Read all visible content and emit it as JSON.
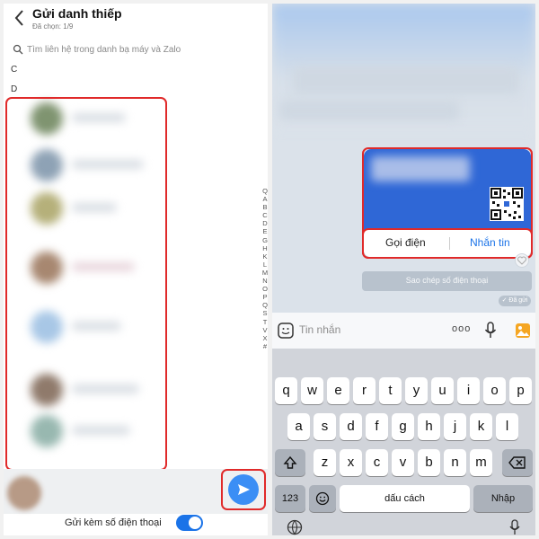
{
  "left": {
    "title": "Gửi danh thiếp",
    "selected_count": "Đã chọn: 1/9",
    "search_placeholder": "Tìm liên hệ trong danh bạ máy và Zalo",
    "sections": [
      "C",
      "D"
    ],
    "alphabet": [
      "Q",
      "A",
      "B",
      "C",
      "D",
      "E",
      "G",
      "H",
      "K",
      "L",
      "M",
      "N",
      "O",
      "P",
      "Q",
      "S",
      "T",
      "V",
      "X",
      "#"
    ],
    "send_with_phone_label": "Gửi kèm số điện thoại",
    "send_with_phone_on": true,
    "contact_avatar_colors": [
      "#7f9470",
      "#8ea2b5",
      "#b5b07a",
      "#a78770",
      "#a8c7e6",
      "#8f7a6b",
      "#98b8b0"
    ]
  },
  "right": {
    "call_label": "Gọi điện",
    "message_label": "Nhắn tin",
    "copy_phone_label": "Sao chép số điện thoại",
    "sent_label": "✓ Đã gửi",
    "input_placeholder": "Tin nhắn",
    "more_label": "ooo",
    "keyboard": {
      "row1": [
        "q",
        "w",
        "e",
        "r",
        "t",
        "y",
        "u",
        "i",
        "o",
        "p"
      ],
      "row2": [
        "a",
        "s",
        "d",
        "f",
        "g",
        "h",
        "j",
        "k",
        "l"
      ],
      "row3": [
        "z",
        "x",
        "c",
        "v",
        "b",
        "n",
        "m"
      ],
      "numbers_key": "123",
      "space_key": "dấu cách",
      "return_key": "Nhập"
    }
  },
  "colors": {
    "accent": "#1a73e8",
    "highlight": "#e02a2a",
    "card_blue": "#2f67d6"
  }
}
